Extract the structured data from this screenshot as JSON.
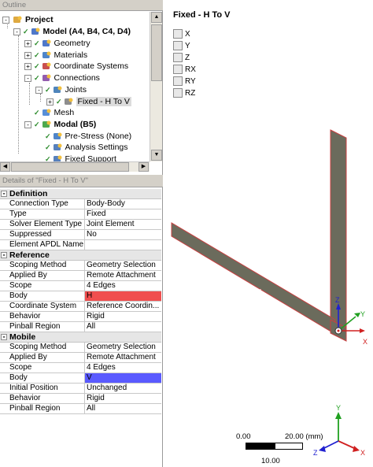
{
  "outline": {
    "title": "Outline",
    "tree": [
      {
        "label": "Project",
        "bold": true,
        "icon": "project-icon"
      },
      {
        "label": "Model (A4, B4, C4, D4)",
        "bold": true,
        "icon": "model-icon"
      },
      {
        "label": "Geometry",
        "icon": "geometry-icon"
      },
      {
        "label": "Materials",
        "icon": "materials-icon"
      },
      {
        "label": "Coordinate Systems",
        "icon": "coordinate-systems-icon"
      },
      {
        "label": "Connections",
        "icon": "connections-icon"
      },
      {
        "label": "Joints",
        "icon": "joints-icon"
      },
      {
        "label": "Fixed - H To V",
        "icon": "fixed-joint-icon",
        "selected": true
      },
      {
        "label": "Mesh",
        "icon": "mesh-icon"
      },
      {
        "label": "Modal (B5)",
        "bold": true,
        "icon": "modal-icon"
      },
      {
        "label": "Pre-Stress (None)",
        "icon": "pre-stress-icon"
      },
      {
        "label": "Analysis Settings",
        "icon": "analysis-settings-icon"
      },
      {
        "label": "Fixed Support",
        "icon": "fixed-support-icon"
      }
    ]
  },
  "details": {
    "title": "Details of \"Fixed - H To V\"",
    "sections": [
      {
        "name": "Definition",
        "rows": [
          {
            "name": "Connection Type",
            "value": "Body-Body"
          },
          {
            "name": "Type",
            "value": "Fixed"
          },
          {
            "name": "Solver Element Type",
            "value": "Joint Element"
          },
          {
            "name": "Suppressed",
            "value": "No"
          },
          {
            "name": "Element APDL Name",
            "value": ""
          }
        ]
      },
      {
        "name": "Reference",
        "rows": [
          {
            "name": "Scoping Method",
            "value": "Geometry Selection"
          },
          {
            "name": "Applied By",
            "value": "Remote Attachment"
          },
          {
            "name": "Scope",
            "value": "4 Edges"
          },
          {
            "name": "Body",
            "value": "H",
            "highlight": "#f04f4f"
          },
          {
            "name": "Coordinate System",
            "value": "Reference Coordin..."
          },
          {
            "name": "Behavior",
            "value": "Rigid"
          },
          {
            "name": "Pinball Region",
            "value": "All"
          }
        ]
      },
      {
        "name": "Mobile",
        "rows": [
          {
            "name": "Scoping Method",
            "value": "Geometry Selection"
          },
          {
            "name": "Applied By",
            "value": "Remote Attachment"
          },
          {
            "name": "Scope",
            "value": "4 Edges"
          },
          {
            "name": "Body",
            "value": "V",
            "highlight": "#5a5aff"
          },
          {
            "name": "Initial Position",
            "value": "Unchanged"
          },
          {
            "name": "Behavior",
            "value": "Rigid"
          },
          {
            "name": "Pinball Region",
            "value": "All"
          }
        ]
      }
    ]
  },
  "graphics": {
    "title": "Fixed - H To V",
    "dofs": [
      "X",
      "Y",
      "Z",
      "RX",
      "RY",
      "RZ"
    ],
    "triad_labels": {
      "x": "X",
      "y": "Y",
      "z": "Z"
    },
    "scale": {
      "left": "0.00",
      "right": "20.00 (mm)",
      "mid": "10.00"
    },
    "colors": {
      "body": "#6b6b5c",
      "edge": "#c84040",
      "triad_x": "#d02020",
      "triad_y": "#20a020",
      "triad_z": "#2020d0"
    }
  }
}
